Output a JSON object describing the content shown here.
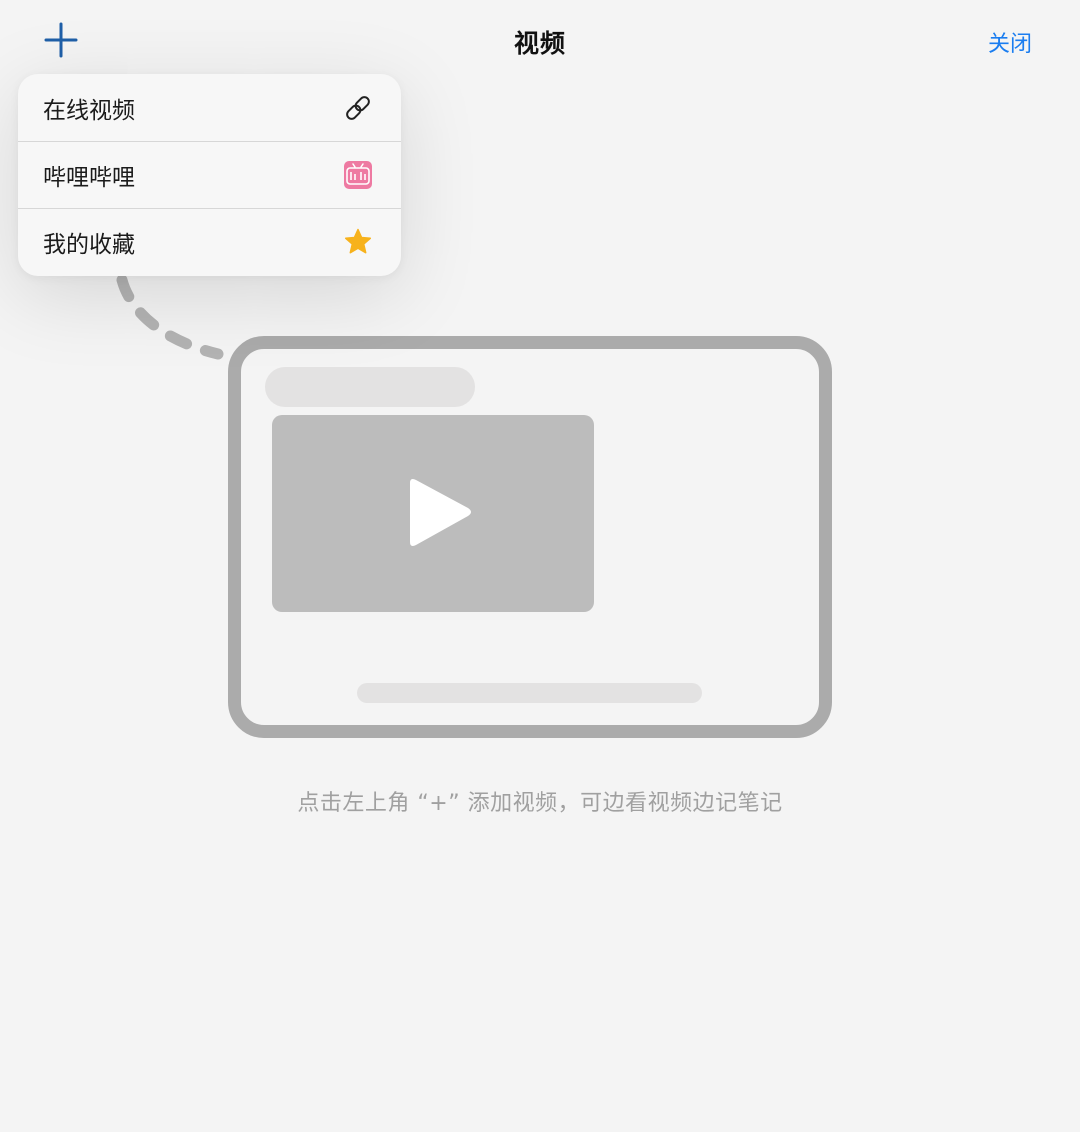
{
  "header": {
    "add_icon": "plus-icon",
    "title": "视频",
    "close_label": "关闭",
    "accent_color": "#1a7df0"
  },
  "menu": {
    "items": [
      {
        "label": "在线视频",
        "icon": "link-icon"
      },
      {
        "label": "哔哩哔哩",
        "icon": "bilibili-icon"
      },
      {
        "label": "我的收藏",
        "icon": "star-icon"
      }
    ]
  },
  "empty_state": {
    "hint": "点击左上角 “+” 添加视频，可边看视频边记笔记",
    "illustration_icon": "play-icon"
  }
}
